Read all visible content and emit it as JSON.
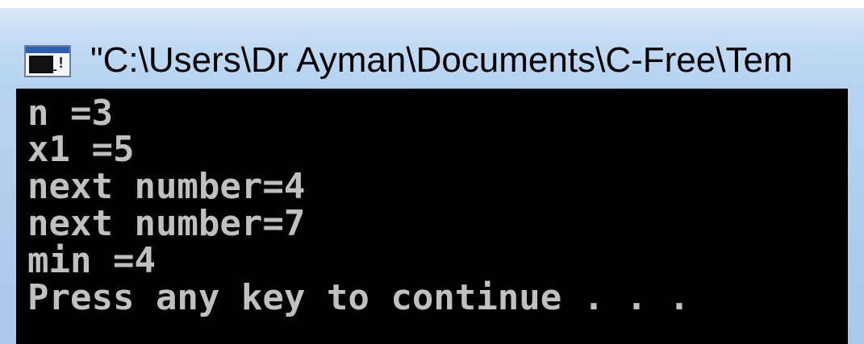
{
  "window": {
    "title": "\"C:\\Users\\Dr Ayman\\Documents\\C-Free\\Tem",
    "icon": "console-icon",
    "icon_prompt": "_!"
  },
  "console": {
    "lines": [
      "n =3",
      "x1 =5",
      "next number=4",
      "next number=7",
      "min =4",
      "Press any key to continue . . ."
    ],
    "foreground": "#c0c0c0",
    "background": "#000000"
  },
  "colors": {
    "titlebar": "#c2dbf4",
    "frame": "#b7d3f1"
  }
}
